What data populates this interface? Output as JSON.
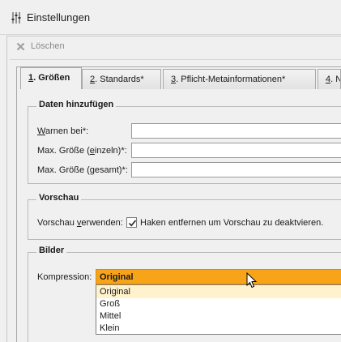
{
  "window": {
    "title": "Einstellungen",
    "title_icon": "sliders-icon"
  },
  "toolbar": {
    "delete_label": "Löschen",
    "delete_icon": "close-icon",
    "disabled": true
  },
  "tabs": [
    {
      "mnemonic": "1",
      "label": ". Größen",
      "active": true
    },
    {
      "mnemonic": "2",
      "label": ". Standards*",
      "active": false
    },
    {
      "mnemonic": "3",
      "label": ". Pflicht-Metainformationen*",
      "active": false
    },
    {
      "mnemonic": "4",
      "label": ". N",
      "active": false
    }
  ],
  "groups": {
    "daten": {
      "title": "Daten hinzufügen",
      "fields": [
        {
          "pre": "",
          "mnemonic": "W",
          "post": "arnen bei*:",
          "value": ""
        },
        {
          "pre": "Max. Größe (",
          "mnemonic": "e",
          "post": "inzeln)*:",
          "value": ""
        },
        {
          "pre": "Max. Größe (",
          "mnemonic": "g",
          "post": "esamt)*:",
          "value": ""
        }
      ]
    },
    "vorschau": {
      "title": "Vorschau",
      "label_pre": "Vorschau ",
      "label_mnemonic": "v",
      "label_post": "erwenden:",
      "checkbox_checked": true,
      "checkbox_label": "Haken entfernen um Vorschau zu deaktvieren."
    },
    "bilder": {
      "title": "Bilder",
      "compression_label": "Kompression:",
      "compression_value": "Original",
      "options": [
        "Original",
        "Groß",
        "Mittel",
        "Klein"
      ],
      "highlighted_option": "Original"
    }
  },
  "colors": {
    "combo_accent": "#f8a418",
    "option_highlight": "#fff2cc",
    "window_bg": "#f0f0f0"
  }
}
